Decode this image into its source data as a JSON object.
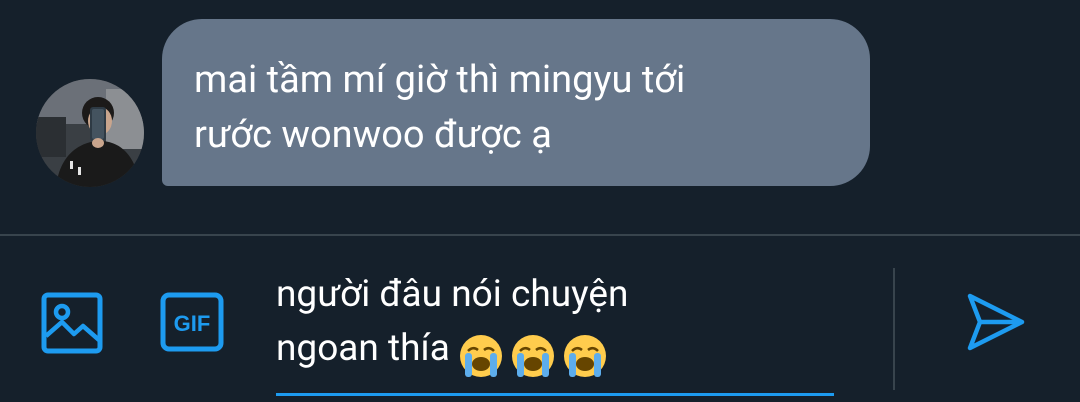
{
  "conversation": {
    "received_message": {
      "text": "mai tầm mí giờ thì mingyu tới\nrước wonwoo được ạ"
    }
  },
  "composer": {
    "draft_text": "người đâu nói chuyện\nngoan thía",
    "draft_emojis": [
      "loudly-crying-face",
      "loudly-crying-face",
      "loudly-crying-face"
    ],
    "icons": {
      "image": "image-icon",
      "gif": "gif-icon",
      "send": "send-icon"
    },
    "gif_label": "GIF"
  },
  "colors": {
    "background": "#15202b",
    "bubble": "#66768a",
    "accent": "#1d9bf0",
    "divider": "#38444d"
  }
}
